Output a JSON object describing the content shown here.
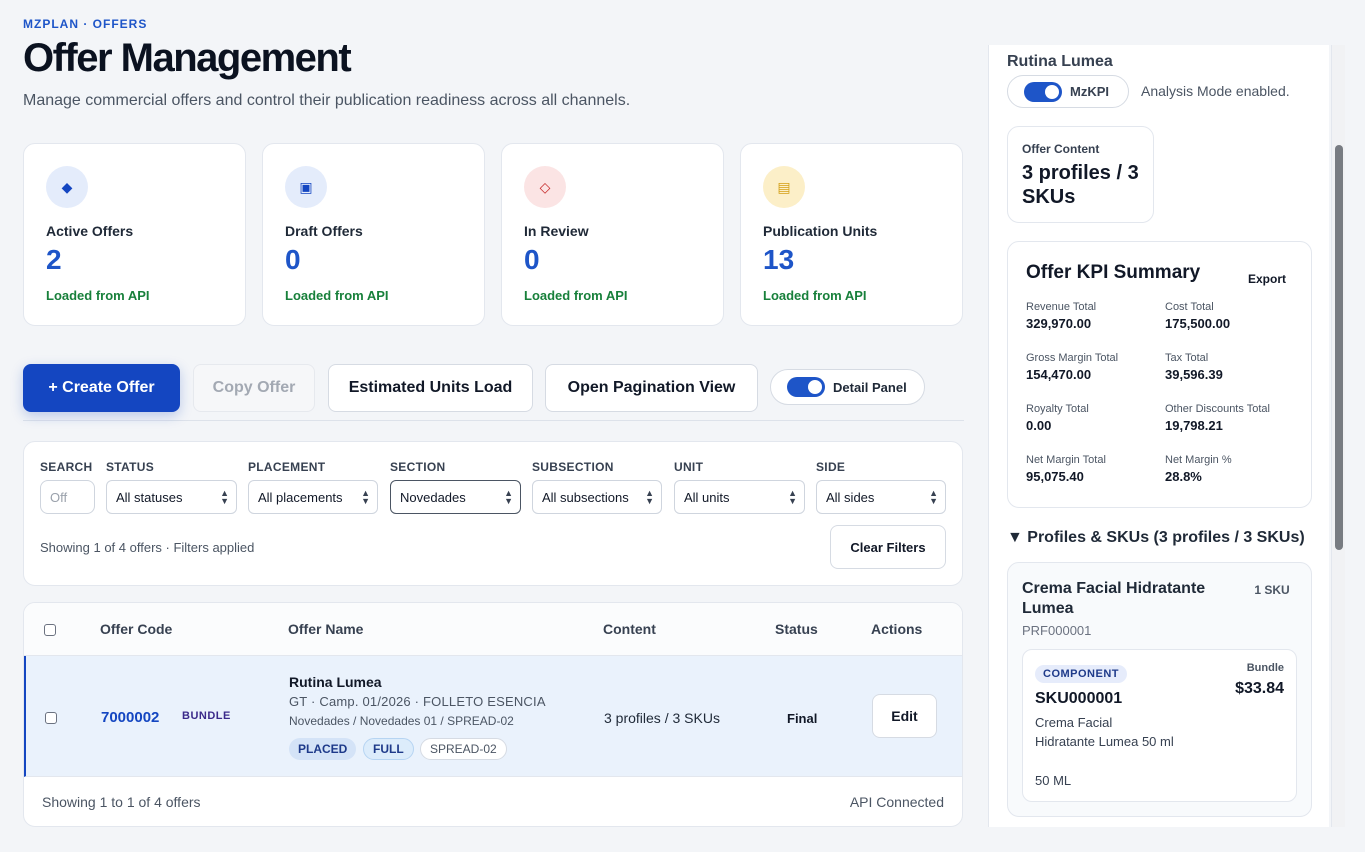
{
  "header": {
    "eyebrow": "MZPLAN · OFFERS",
    "title": "Offer Management",
    "subtitle": "Manage commercial offers and control their publication readiness across all channels."
  },
  "kpis": [
    {
      "label": "Active Offers",
      "value": "2",
      "source": "Loaded from API",
      "icon": "diamond-icon",
      "glyph": "◆",
      "bg": "#e4ecfb",
      "fg": "#1446c1"
    },
    {
      "label": "Draft Offers",
      "value": "0",
      "source": "Loaded from API",
      "icon": "square-icon",
      "glyph": "▣",
      "bg": "#e4ecfb",
      "fg": "#1446c1"
    },
    {
      "label": "In Review",
      "value": "0",
      "source": "Loaded from API",
      "icon": "diamond-outline-icon",
      "glyph": "◇",
      "bg": "#fbe4e4",
      "fg": "#c62828"
    },
    {
      "label": "Publication Units",
      "value": "13",
      "source": "Loaded from API",
      "icon": "list-icon",
      "glyph": "▤",
      "bg": "#fcefc8",
      "fg": "#d4a017"
    }
  ],
  "toolbar": {
    "create": "+ Create Offer",
    "copy": "Copy Offer",
    "estimated": "Estimated Units Load",
    "pagination": "Open Pagination View",
    "detail_panel": "Detail Panel"
  },
  "filters": {
    "search_label": "SEARCH",
    "search_placeholder": "Off",
    "status_label": "STATUS",
    "status_value": "All statuses",
    "placement_label": "PLACEMENT",
    "placement_value": "All placements",
    "section_label": "SECTION",
    "section_value": "Novedades",
    "subsection_label": "SUBSECTION",
    "subsection_value": "All subsections",
    "unit_label": "UNIT",
    "unit_value": "All units",
    "side_label": "SIDE",
    "side_value": "All sides",
    "summary": "Showing 1 of 4 offers · Filters applied",
    "clear": "Clear Filters"
  },
  "table": {
    "headers": {
      "code": "Offer Code",
      "name": "Offer Name",
      "content": "Content",
      "status": "Status",
      "actions": "Actions"
    },
    "row": {
      "code": "7000002",
      "type": "BUNDLE",
      "name": "Rutina Lumea",
      "meta": "GT · Camp. 01/2026 · FOLLETO ESENCIA",
      "path": "Novedades / Novedades 01 / SPREAD-02",
      "tags": [
        "PLACED",
        "FULL",
        "SPREAD-02"
      ],
      "content": "3 profiles / 3 SKUs",
      "status": "Final",
      "action": "Edit"
    },
    "footer_left": "Showing 1 to 1 of 4 offers",
    "footer_right": "API Connected"
  },
  "panel": {
    "title": "Rutina Lumea",
    "mz_label": "MzKPI",
    "analysis": "Analysis Mode enabled.",
    "offer_content_label": "Offer Content",
    "offer_content_value": "3 profiles / 3 SKUs",
    "kpi_title": "Offer KPI Summary",
    "export": "Export",
    "kpis": [
      {
        "label": "Revenue Total",
        "value": "329,970.00"
      },
      {
        "label": "Cost Total",
        "value": "175,500.00"
      },
      {
        "label": "Gross Margin Total",
        "value": "154,470.00"
      },
      {
        "label": "Tax Total",
        "value": "39,596.39"
      },
      {
        "label": "Royalty Total",
        "value": "0.00"
      },
      {
        "label": "Other Discounts Total",
        "value": "19,798.21"
      },
      {
        "label": "Net Margin Total",
        "value": "95,075.40"
      },
      {
        "label": "Net Margin %",
        "value": "28.8%"
      }
    ],
    "profiles_heading": "▼ Profiles & SKUs (3 profiles / 3 SKUs)",
    "profile": {
      "name": "Crema Facial Hidratante Lumea",
      "sku_count": "1 SKU",
      "id": "PRF000001",
      "sku": {
        "role": "COMPONENT",
        "type": "Bundle",
        "price": "$33.84",
        "code": "SKU000001",
        "desc": "Crema Facial Hidratante Lumea 50 ml",
        "size": "50 ML"
      }
    }
  }
}
